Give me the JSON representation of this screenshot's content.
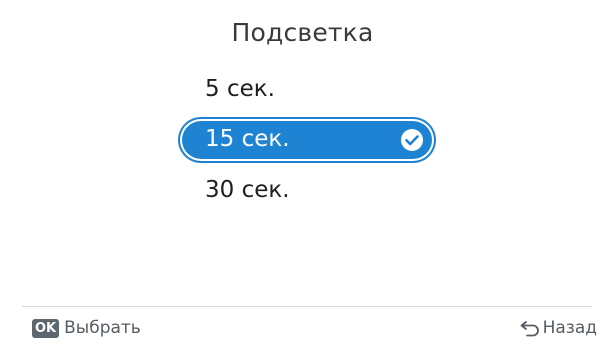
{
  "screen": {
    "title": "Подсветка"
  },
  "options": [
    {
      "label": "5 сек.",
      "selected": false
    },
    {
      "label": "15 сек.",
      "selected": true
    },
    {
      "label": "30 сек.",
      "selected": false
    }
  ],
  "footer": {
    "ok_badge": "OK",
    "select_label": "Выбрать",
    "back_label": "Назад"
  },
  "colors": {
    "accent": "#1f83d4",
    "text": "#1e1e1e",
    "muted": "#555c63"
  },
  "icons": {
    "selected": "check-circle-icon",
    "back": "undo-arrow-icon"
  }
}
